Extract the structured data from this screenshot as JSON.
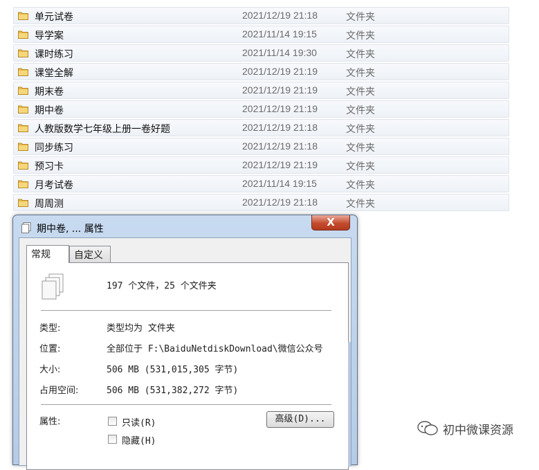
{
  "files": [
    {
      "name": "单元试卷",
      "date": "2021/12/19 21:18",
      "type": "文件夹"
    },
    {
      "name": "导学案",
      "date": "2021/11/14 19:15",
      "type": "文件夹"
    },
    {
      "name": "课时练习",
      "date": "2021/11/14 19:30",
      "type": "文件夹"
    },
    {
      "name": "课堂全解",
      "date": "2021/12/19 21:19",
      "type": "文件夹"
    },
    {
      "name": "期末卷",
      "date": "2021/12/19 21:19",
      "type": "文件夹"
    },
    {
      "name": "期中卷",
      "date": "2021/12/19 21:19",
      "type": "文件夹"
    },
    {
      "name": "人教版数学七年级上册一卷好题",
      "date": "2021/12/19 21:18",
      "type": "文件夹"
    },
    {
      "name": "同步练习",
      "date": "2021/12/19 21:18",
      "type": "文件夹"
    },
    {
      "name": "预习卡",
      "date": "2021/12/19 21:19",
      "type": "文件夹"
    },
    {
      "name": "月考试卷",
      "date": "2021/11/14 19:15",
      "type": "文件夹"
    },
    {
      "name": "周周测",
      "date": "2021/12/19 21:18",
      "type": "文件夹"
    }
  ],
  "dialog": {
    "title": "期中卷, ... 属性",
    "close_label": "X",
    "tabs": [
      {
        "label": "常规"
      },
      {
        "label": "自定义"
      }
    ],
    "summary": "197 个文件，25 个文件夹",
    "type_label": "类型:",
    "type_value": "类型均为 文件夹",
    "location_label": "位置:",
    "location_value": "全部位于 F:\\BaiduNetdiskDownload\\微信公众号",
    "size_label": "大小:",
    "size_value": "506 MB (531,015,305 字节)",
    "disk_label": "占用空间:",
    "disk_value": "506 MB (531,382,272 字节)",
    "attributes_label": "属性:",
    "readonly_label": "只读(R)",
    "hidden_label": "隐藏(H)",
    "readonly_checked": false,
    "hidden_checked": false,
    "advanced_label": "高级(D)..."
  },
  "watermark": {
    "text": "初中微课资源",
    "icon": "wechat-icon"
  },
  "colors": {
    "folder": "#e8b84a",
    "close": "#c44b2e",
    "titlebar": "#c7daf0"
  }
}
